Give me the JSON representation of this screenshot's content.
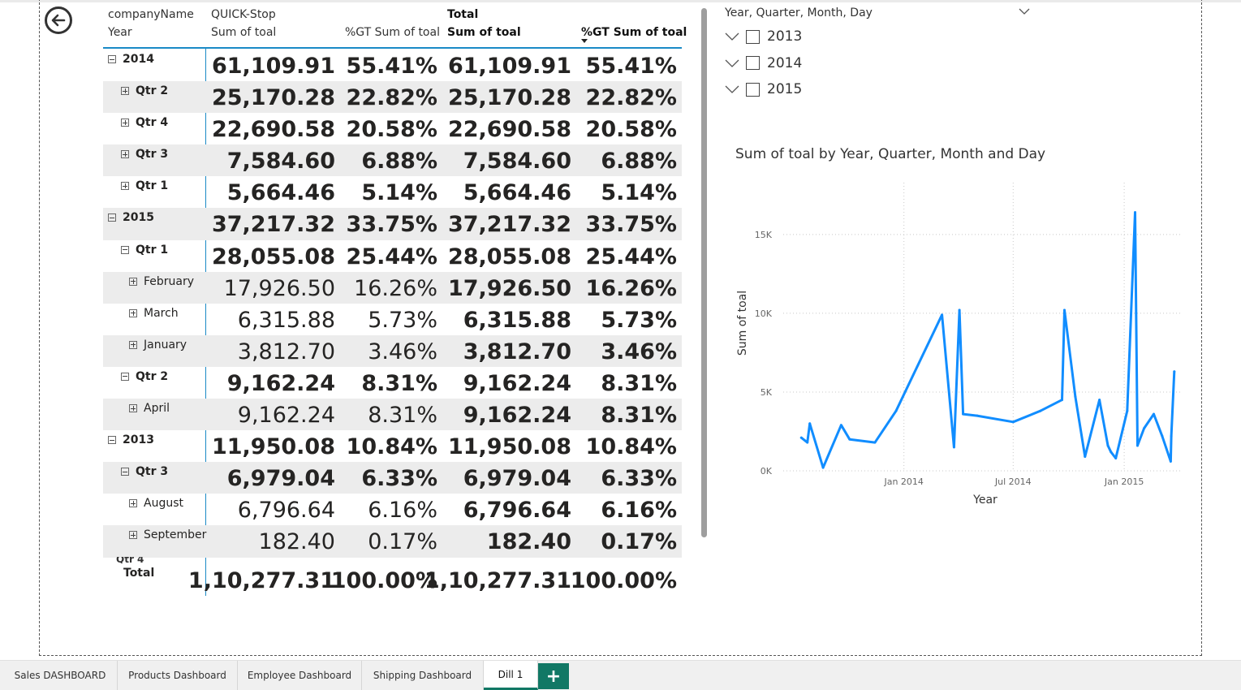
{
  "matrix": {
    "headers": {
      "row1_col0": "companyName",
      "row2_col0": "Year",
      "row1_col1": "QUICK-Stop",
      "row2_col1": "Sum of toal",
      "row2_col2": "%GT Sum of toal",
      "row1_col3": "Total",
      "row2_col3": "Sum of toal",
      "row2_col4": "%GT Sum of toal"
    },
    "rows": [
      {
        "label": "2014",
        "level": 0,
        "expander": "minus",
        "bold": true,
        "values": [
          "61,109.91",
          "55.41%",
          "61,109.91",
          "55.41%"
        ],
        "shade": false
      },
      {
        "label": "Qtr 2",
        "level": 1,
        "expander": "plus",
        "bold": true,
        "values": [
          "25,170.28",
          "22.82%",
          "25,170.28",
          "22.82%"
        ],
        "shade": true
      },
      {
        "label": "Qtr 4",
        "level": 1,
        "expander": "plus",
        "bold": true,
        "values": [
          "22,690.58",
          "20.58%",
          "22,690.58",
          "20.58%"
        ],
        "shade": false
      },
      {
        "label": "Qtr 3",
        "level": 1,
        "expander": "plus",
        "bold": true,
        "values": [
          "7,584.60",
          "6.88%",
          "7,584.60",
          "6.88%"
        ],
        "shade": true
      },
      {
        "label": "Qtr 1",
        "level": 1,
        "expander": "plus",
        "bold": true,
        "values": [
          "5,664.46",
          "5.14%",
          "5,664.46",
          "5.14%"
        ],
        "shade": false
      },
      {
        "label": "2015",
        "level": 0,
        "expander": "minus",
        "bold": true,
        "values": [
          "37,217.32",
          "33.75%",
          "37,217.32",
          "33.75%"
        ],
        "shade": true
      },
      {
        "label": "Qtr 1",
        "level": 1,
        "expander": "minus",
        "bold": true,
        "values": [
          "28,055.08",
          "25.44%",
          "28,055.08",
          "25.44%"
        ],
        "shade": false
      },
      {
        "label": "February",
        "level": 2,
        "expander": "plus",
        "bold": false,
        "values": [
          "17,926.50",
          "16.26%",
          "17,926.50",
          "16.26%"
        ],
        "shade": true
      },
      {
        "label": "March",
        "level": 2,
        "expander": "plus",
        "bold": false,
        "values": [
          "6,315.88",
          "5.73%",
          "6,315.88",
          "5.73%"
        ],
        "shade": false
      },
      {
        "label": "January",
        "level": 2,
        "expander": "plus",
        "bold": false,
        "values": [
          "3,812.70",
          "3.46%",
          "3,812.70",
          "3.46%"
        ],
        "shade": true
      },
      {
        "label": "Qtr 2",
        "level": 1,
        "expander": "minus",
        "bold": true,
        "values": [
          "9,162.24",
          "8.31%",
          "9,162.24",
          "8.31%"
        ],
        "shade": false
      },
      {
        "label": "April",
        "level": 2,
        "expander": "plus",
        "bold": false,
        "values": [
          "9,162.24",
          "8.31%",
          "9,162.24",
          "8.31%"
        ],
        "shade": true
      },
      {
        "label": "2013",
        "level": 0,
        "expander": "minus",
        "bold": true,
        "values": [
          "11,950.08",
          "10.84%",
          "11,950.08",
          "10.84%"
        ],
        "shade": false
      },
      {
        "label": "Qtr 3",
        "level": 1,
        "expander": "minus",
        "bold": true,
        "values": [
          "6,979.04",
          "6.33%",
          "6,979.04",
          "6.33%"
        ],
        "shade": true
      },
      {
        "label": "August",
        "level": 2,
        "expander": "plus",
        "bold": false,
        "values": [
          "6,796.64",
          "6.16%",
          "6,796.64",
          "6.16%"
        ],
        "shade": false
      },
      {
        "label": "September",
        "level": 2,
        "expander": "plus",
        "bold": false,
        "values": [
          "182.40",
          "0.17%",
          "182.40",
          "0.17%"
        ],
        "shade": true
      }
    ],
    "partial_row_label": "Qtr 4",
    "total": {
      "label": "Total",
      "values": [
        "1,10,277.31",
        "100.00%",
        "1,10,277.31",
        "100.00%"
      ]
    }
  },
  "slicer": {
    "title": "Year, Quarter, Month, Day",
    "items": [
      {
        "label": "2013",
        "checked": false
      },
      {
        "label": "2014",
        "checked": false
      },
      {
        "label": "2015",
        "checked": false
      }
    ]
  },
  "chart_data": {
    "type": "line",
    "title": "Sum of toal by Year, Quarter, Month and Day",
    "xlabel": "Year",
    "ylabel": "Sum of toal",
    "x_ticks": [
      "Jan 2014",
      "Jul 2014",
      "Jan 2015"
    ],
    "y_ticks": [
      "0K",
      "5K",
      "10K",
      "15K"
    ],
    "ylim": [
      0,
      17000
    ],
    "color": "#118DFF",
    "grid": true,
    "series": [
      {
        "x": [
          "2013-07-15",
          "2013-07-25",
          "2013-07-29",
          "2013-08-20",
          "2013-09-19",
          "2013-10-03",
          "2013-11-14",
          "2013-12-19",
          "2014-03-05",
          "2014-03-25",
          "2014-04-03",
          "2014-04-09",
          "2014-05-02",
          "2014-07-01",
          "2014-08-15",
          "2014-09-20",
          "2014-09-24",
          "2014-10-12",
          "2014-10-28",
          "2014-11-21",
          "2014-12-05",
          "2014-12-10",
          "2014-12-18",
          "2015-01-06",
          "2015-01-19",
          "2015-01-23",
          "2015-02-03",
          "2015-02-19",
          "2015-03-05",
          "2015-03-19",
          "2015-03-20",
          "2015-03-25"
        ],
        "y": [
          2100,
          1800,
          3000,
          200,
          2900,
          2000,
          1800,
          3800,
          9900,
          1500,
          10200,
          3600,
          3500,
          3100,
          3800,
          4500,
          10200,
          4700,
          900,
          4500,
          1600,
          1200,
          800,
          3800,
          16400,
          1600,
          2700,
          3600,
          2200,
          600,
          2200,
          6300
        ]
      }
    ]
  },
  "tabs": [
    {
      "label": "Sales DASHBOARD",
      "active": false
    },
    {
      "label": "Products Dashboard",
      "active": false
    },
    {
      "label": "Employee Dashboard",
      "active": false
    },
    {
      "label": "Shipping Dashboard",
      "active": false
    },
    {
      "label": "Dill 1",
      "active": true
    }
  ],
  "add_tab_label": "+"
}
